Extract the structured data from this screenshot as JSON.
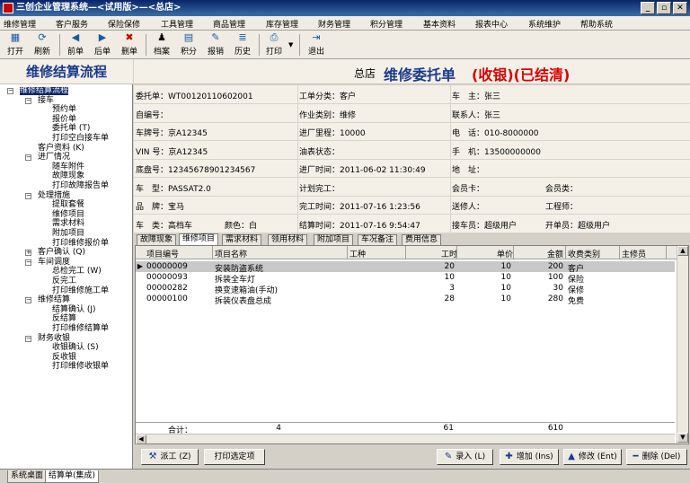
{
  "window": {
    "title": "三创企业管理系统—<试用版>—<总店>",
    "minimize": "_",
    "restore": "▫",
    "close": "✕"
  },
  "menu": [
    "维修管理",
    "客户服务",
    "保险保修",
    "工具管理",
    "商品管理",
    "库存管理",
    "财务管理",
    "积分管理",
    "基本资料",
    "报表中心",
    "系统维护",
    "帮助系统"
  ],
  "toolbar": [
    {
      "label": "打开",
      "icon": "▦"
    },
    {
      "label": "刷新",
      "icon": "⟳"
    },
    {
      "label": "前单",
      "icon": "◀"
    },
    {
      "label": "后单",
      "icon": "▶"
    },
    {
      "label": "删单",
      "icon": "✖"
    },
    {
      "label": "档案",
      "icon": "♟"
    },
    {
      "label": "积分",
      "icon": "▤"
    },
    {
      "label": "报销",
      "icon": "✎"
    },
    {
      "label": "历史",
      "icon": "≣"
    },
    {
      "label": "打印",
      "icon": "⎙"
    },
    {
      "label": "退出",
      "icon": "⇥"
    }
  ],
  "left": {
    "title": "维修结算流程",
    "tree": [
      {
        "label": "维修结算流程",
        "level": 0,
        "toggle": "−",
        "selected": true
      },
      {
        "label": "接车",
        "level": 1,
        "toggle": "−"
      },
      {
        "label": "预约单",
        "level": 2
      },
      {
        "label": "报价单",
        "level": 2
      },
      {
        "label": "委托单 (T)",
        "level": 2
      },
      {
        "label": "打印空白接车单",
        "level": 2
      },
      {
        "label": "客户资料 (K)",
        "level": 1
      },
      {
        "label": "进厂情况",
        "level": 1,
        "toggle": "−"
      },
      {
        "label": "随车附件",
        "level": 2
      },
      {
        "label": "故障现象",
        "level": 2
      },
      {
        "label": "打印故障报告单",
        "level": 2
      },
      {
        "label": "处理措施",
        "level": 1,
        "toggle": "−"
      },
      {
        "label": "提取套餐",
        "level": 2
      },
      {
        "label": "维修项目",
        "level": 2
      },
      {
        "label": "需求材料",
        "level": 2
      },
      {
        "label": "附加项目",
        "level": 2
      },
      {
        "label": "打印维修报价单",
        "level": 2
      },
      {
        "label": "客户确认 (Q)",
        "level": 1,
        "toggle": "+"
      },
      {
        "label": "车间调度",
        "level": 1,
        "toggle": "−"
      },
      {
        "label": "总检完工 (W)",
        "level": 2
      },
      {
        "label": "反完工",
        "level": 2
      },
      {
        "label": "打印维修施工单",
        "level": 2
      },
      {
        "label": "维修结算",
        "level": 1,
        "toggle": "−"
      },
      {
        "label": "结算确认 (J)",
        "level": 2
      },
      {
        "label": "反结算",
        "level": 2
      },
      {
        "label": "打印维修结算单",
        "level": 2
      },
      {
        "label": "财务收银",
        "level": 1,
        "toggle": "−"
      },
      {
        "label": "收银确认 (S)",
        "level": 2
      },
      {
        "label": "反收银",
        "level": 2
      },
      {
        "label": "打印维修收银单",
        "level": 2
      }
    ]
  },
  "header": {
    "store": "总店",
    "title": "维修委托单",
    "status": "(收银)(已结清)"
  },
  "info": [
    [
      {
        "k": "委托单：",
        "v": "WT00120110602001"
      },
      {
        "k": "工单分类：",
        "v": "客户"
      },
      {
        "k": "车　主：",
        "v": "张三"
      }
    ],
    [
      {
        "k": "自编号：",
        "v": ""
      },
      {
        "k": "作业类别：",
        "v": "维修"
      },
      {
        "k": "联系人：",
        "v": "张三"
      }
    ],
    [
      {
        "k": "车牌号：",
        "v": "京A12345"
      },
      {
        "k": "进厂里程：",
        "v": "10000"
      },
      {
        "k": "电　话：",
        "v": "010-8000000"
      }
    ],
    [
      {
        "k": "VIN 号：",
        "v": "京A12345"
      },
      {
        "k": "油表状态：",
        "v": ""
      },
      {
        "k": "手　机：",
        "v": "13500000000"
      }
    ],
    [
      {
        "k": "底盘号：",
        "v": "12345678901234567"
      },
      {
        "k": "进厂时间：",
        "v": "2011-06-02 11:30:49"
      },
      {
        "k": "地　址：",
        "v": ""
      }
    ],
    [
      {
        "k": "车　型：",
        "v": "PASSAT2.0"
      },
      {
        "k": "计划完工：",
        "v": ""
      },
      {
        "k": "会员卡：",
        "v": ""
      },
      {
        "k": "会员类：",
        "v": ""
      }
    ],
    [
      {
        "k": "品　牌：",
        "v": "宝马"
      },
      {
        "k": "完工时间：",
        "v": "2011-07-16 1:23:56"
      },
      {
        "k": "送修人：",
        "v": ""
      },
      {
        "k": "工程师：",
        "v": ""
      }
    ],
    [
      {
        "k": "车　类：",
        "v": "高档车"
      },
      {
        "k": "颜色：",
        "v": "白"
      },
      {
        "k": "结算时间：",
        "v": "2011-07-16 9:54:47"
      },
      {
        "k": "接车员：",
        "v": "超级用户"
      },
      {
        "k": "开单员：",
        "v": "超级用户"
      }
    ]
  ],
  "tabs": [
    "故障现象",
    "维修项目",
    "需求材料",
    "领用材料",
    "附加项目",
    "车况备注",
    "费用信息"
  ],
  "grid": {
    "columns": [
      "项目编号",
      "项目名称",
      "工种",
      "工时",
      "单价",
      "金额",
      "收费类别",
      "主修员"
    ],
    "rows": [
      [
        "00000009",
        "安装防盗系统",
        "",
        "20",
        "10",
        "200",
        "客户",
        ""
      ],
      [
        "00000093",
        "拆装全车灯",
        "",
        "10",
        "10",
        "100",
        "保险",
        ""
      ],
      [
        "00000282",
        "换变速箱油(手动)",
        "",
        "3",
        "10",
        "30",
        "保修",
        ""
      ],
      [
        "00000100",
        "拆装仪表盘总成",
        "",
        "28",
        "10",
        "280",
        "免费",
        ""
      ]
    ],
    "total": {
      "label": "合计：",
      "count": "4",
      "hours": "61",
      "amount": "610"
    }
  },
  "buttons": {
    "dispatch": "派工 (Z)",
    "print_selected": "打印选定项",
    "enter": "录入 (L)",
    "add": "增加 (Ins)",
    "edit": "修改 (Ent)",
    "delete": "删除 (Del)"
  },
  "status_tabs": [
    "系统桌面",
    "结算单(集成)"
  ]
}
